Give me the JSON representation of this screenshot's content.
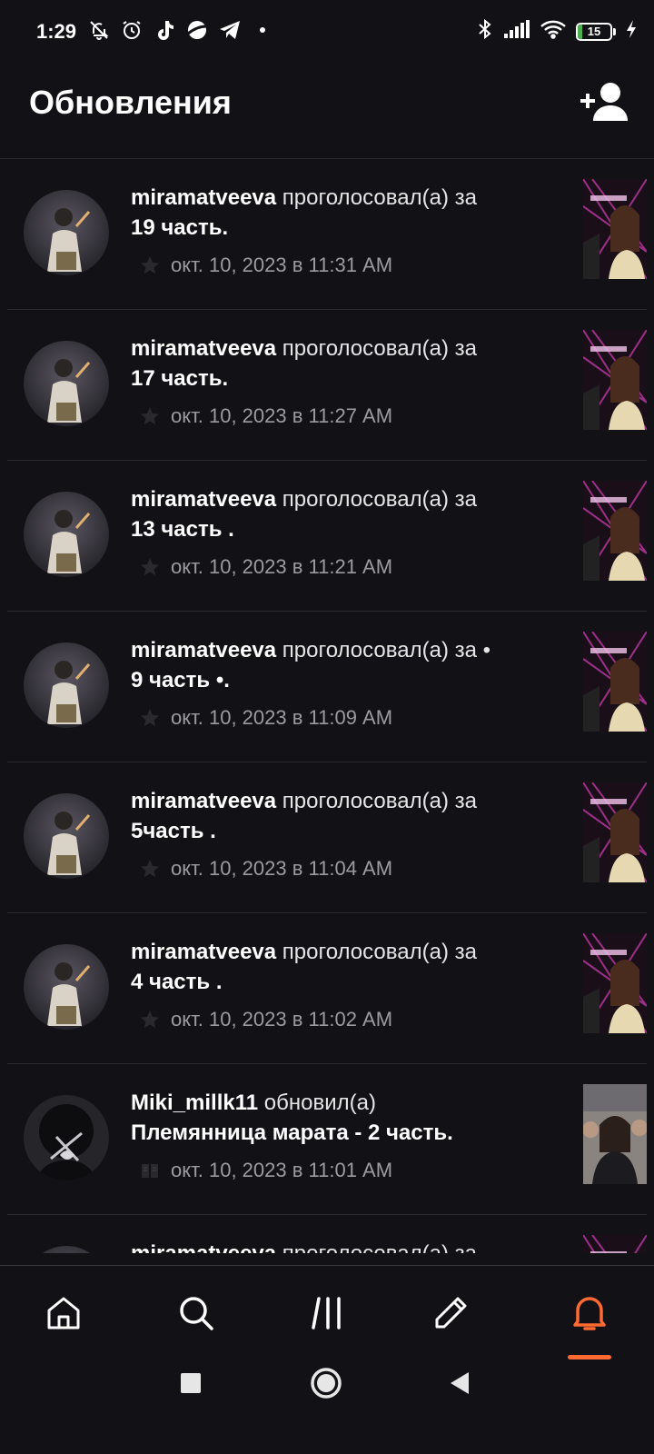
{
  "status_bar": {
    "time": "1:29",
    "left_icons": [
      "bell-off-icon",
      "alarm-icon",
      "tiktok-icon",
      "planet-icon",
      "telegram-icon",
      "dot-icon"
    ],
    "right_icons": [
      "bluetooth-icon",
      "signal-icon",
      "wifi-icon",
      "battery-icon",
      "charging-icon"
    ],
    "battery_level": "15",
    "battery_percent": 15,
    "battery_color": "#4caf50"
  },
  "header": {
    "title": "Обновления",
    "add_friend_icon": "add-user-icon"
  },
  "feed": {
    "items": [
      {
        "user": "miramatveeva",
        "verb": "проголосовал(а) за",
        "part": "19 часть.",
        "date": "окт. 10, 2023 в 11:31 AM",
        "icon": "star-icon"
      },
      {
        "user": "miramatveeva",
        "verb": "проголосовал(а) за",
        "part": "17 часть.",
        "date": "окт. 10, 2023 в 11:27 AM",
        "icon": "star-icon"
      },
      {
        "user": "miramatveeva",
        "verb": "проголосовал(а) за",
        "part": "13 часть .",
        "date": "окт. 10, 2023 в 11:21 AM",
        "icon": "star-icon"
      },
      {
        "user": "miramatveeva",
        "verb": "проголосовал(а) за •",
        "part": "9 часть •.",
        "date": "окт. 10, 2023 в 11:09 AM",
        "icon": "star-icon"
      },
      {
        "user": "miramatveeva",
        "verb": "проголосовал(а) за",
        "part": "5часть .",
        "date": "окт. 10, 2023 в 11:04 AM",
        "icon": "star-icon"
      },
      {
        "user": "miramatveeva",
        "verb": "проголосовал(а) за",
        "part": "4 часть .",
        "date": "окт. 10, 2023 в 11:02 AM",
        "icon": "star-icon"
      },
      {
        "user": "Miki_millk11",
        "verb": "обновил(а)",
        "part": "Племянница марата - 2 часть.",
        "date": "окт. 10, 2023 в 11:01 AM",
        "icon": "book-icon"
      },
      {
        "user": "miramatveeva",
        "verb": "проголосовал(а) за",
        "part": "",
        "date": "",
        "icon": "star-icon"
      }
    ]
  },
  "bottom_nav": {
    "items": [
      "home-icon",
      "search-icon",
      "library-icon",
      "write-icon",
      "notifications-icon"
    ],
    "active_color": "#ff6a32"
  },
  "system_nav": [
    "recents-button",
    "home-button",
    "back-button"
  ]
}
